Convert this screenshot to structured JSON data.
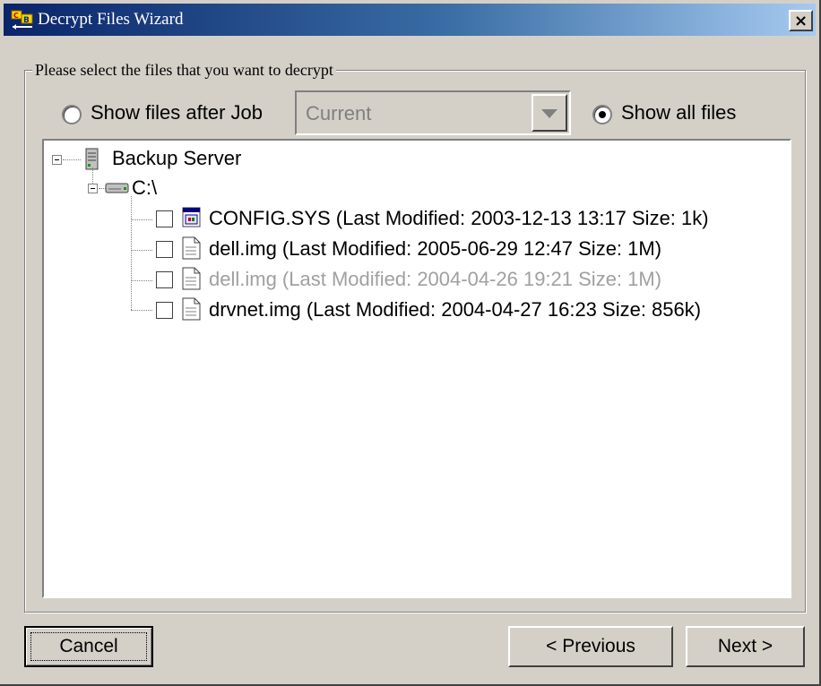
{
  "window": {
    "title": "Decrypt Files Wizard",
    "close_label": "×"
  },
  "group": {
    "legend": "Please select the files that you want to decrypt"
  },
  "filter": {
    "show_after_job_label": "Show files after Job",
    "show_after_job_selected": false,
    "job_combo_value": "Current",
    "show_all_label": "Show all files",
    "show_all_selected": true
  },
  "tree": {
    "root": {
      "label": "Backup Server",
      "expanded": true
    },
    "drive": {
      "label": "C:\\",
      "expanded": true
    },
    "files": [
      {
        "label": "CONFIG.SYS (Last Modified: 2003-12-13 13:17 Size: 1k)",
        "checked": false,
        "enabled": true,
        "icon": "system-file-icon"
      },
      {
        "label": "dell.img (Last Modified: 2005-06-29 12:47 Size: 1M)",
        "checked": false,
        "enabled": true,
        "icon": "document-icon"
      },
      {
        "label": "dell.img (Last Modified: 2004-04-26 19:21 Size: 1M)",
        "checked": false,
        "enabled": false,
        "icon": "document-icon"
      },
      {
        "label": "drvnet.img (Last Modified: 2004-04-27 16:23 Size: 856k)",
        "checked": false,
        "enabled": true,
        "icon": "document-icon"
      }
    ]
  },
  "buttons": {
    "cancel": "Cancel",
    "previous": "< Previous",
    "next": "Next >"
  },
  "colors": {
    "title_gradient_start": "#0a246a",
    "title_gradient_end": "#a6caf0",
    "face": "#d4d0c8",
    "disabled_text": "#a0a0a0"
  }
}
